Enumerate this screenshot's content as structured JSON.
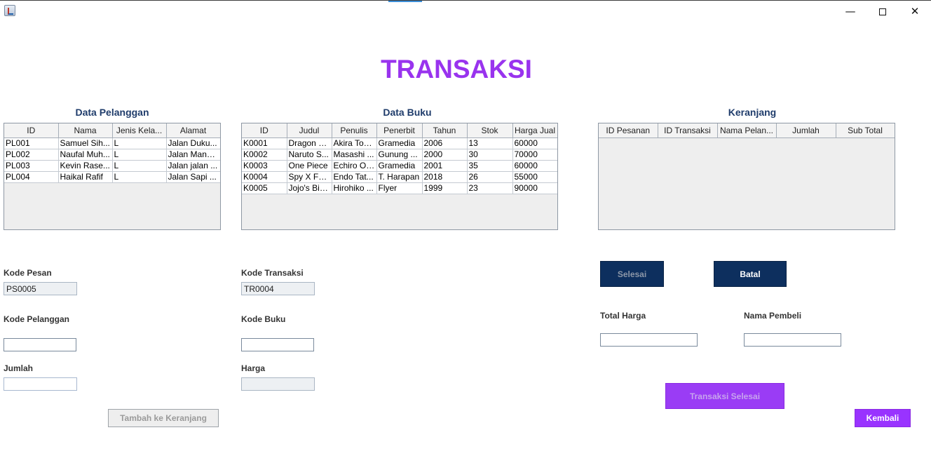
{
  "window": {
    "minimize_glyph": "—",
    "close_glyph": "✕"
  },
  "page_title": "TRANSAKSI",
  "pelanggan": {
    "title": "Data Pelanggan",
    "columns": [
      "ID",
      "Nama",
      "Jenis Kela...",
      "Alamat"
    ],
    "rows": [
      [
        "PL001",
        "Samuel Sih...",
        "L",
        "Jalan Duku..."
      ],
      [
        "PL002",
        "Naufal Muh...",
        "L",
        "Jalan Mang..."
      ],
      [
        "PL003",
        "Kevin Rase...",
        "L",
        "Jalan jalan ..."
      ],
      [
        "PL004",
        "Haikal Rafif",
        "L",
        "Jalan Sapi ..."
      ]
    ]
  },
  "buku": {
    "title": "Data Buku",
    "columns": [
      "ID",
      "Judul",
      "Penulis",
      "Penerbit",
      "Tahun",
      "Stok",
      "Harga Jual"
    ],
    "rows": [
      [
        "K0001",
        "Dragon B...",
        "Akira Tori...",
        "Gramedia",
        "2006",
        "13",
        "60000"
      ],
      [
        "K0002",
        "Naruto S...",
        "Masashi ...",
        "Gunung ...",
        "2000",
        "30",
        "70000"
      ],
      [
        "K0003",
        "One Piece",
        "Echiro Oda",
        "Gramedia",
        "2001",
        "35",
        "60000"
      ],
      [
        "K0004",
        "Spy X Fa...",
        "Endo Tat...",
        "T. Harapan",
        "2018",
        "26",
        "55000"
      ],
      [
        "K0005",
        "Jojo's Biz...",
        "Hirohiko ...",
        "Flyer",
        "1999",
        "23",
        "90000"
      ]
    ]
  },
  "keranjang": {
    "title": "Keranjang",
    "columns": [
      "ID Pesanan",
      "ID Transaksi",
      "Nama Pelan...",
      "Jumlah",
      "Sub Total"
    ],
    "rows": []
  },
  "form": {
    "kode_pesan_label": "Kode Pesan",
    "kode_pesan_value": "PS0005",
    "kode_transaksi_label": "Kode Transaksi",
    "kode_transaksi_value": "TR0004",
    "kode_pelanggan_label": "Kode Pelanggan",
    "kode_pelanggan_value": "",
    "kode_buku_label": "Kode Buku",
    "kode_buku_value": "",
    "jumlah_label": "Jumlah",
    "jumlah_value": "",
    "harga_label": "Harga",
    "harga_value": "",
    "total_harga_label": "Total Harga",
    "total_harga_value": "",
    "nama_pembeli_label": "Nama Pembeli",
    "nama_pembeli_value": ""
  },
  "buttons": {
    "tambah": "Tambah ke Keranjang",
    "selesai": "Selesai",
    "batal": "Batal",
    "transaksi_selesai": "Transaksi Selesai",
    "kembali": "Kembali"
  }
}
